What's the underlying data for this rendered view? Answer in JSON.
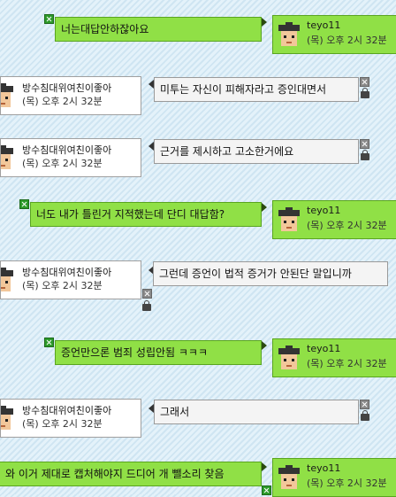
{
  "me": {
    "nick": "teyo11",
    "time": "(목) 오후 2시 32분"
  },
  "other": {
    "nick": "방수침대위여친이좋아",
    "time": "(목) 오후 2시 32분"
  },
  "messages": [
    {
      "text": "너는대답안하잖아요"
    },
    {
      "text": "미투는 자신이 피해자라고 증인대면서"
    },
    {
      "text": "근거를 제시하고 고소한거에요"
    },
    {
      "text": "너도 내가 틀린거 지적했는데 단디 대답함?"
    },
    {
      "text": "그런데 증언이 법적 증거가 안된단 말입니까"
    },
    {
      "text": "증언만으론 범죄 성립안됨 ㅋㅋㅋ"
    },
    {
      "text": "그래서"
    },
    {
      "text": "와 이거 제대로 캡처해야지 드디어 개 뺄소리 찾음"
    }
  ]
}
